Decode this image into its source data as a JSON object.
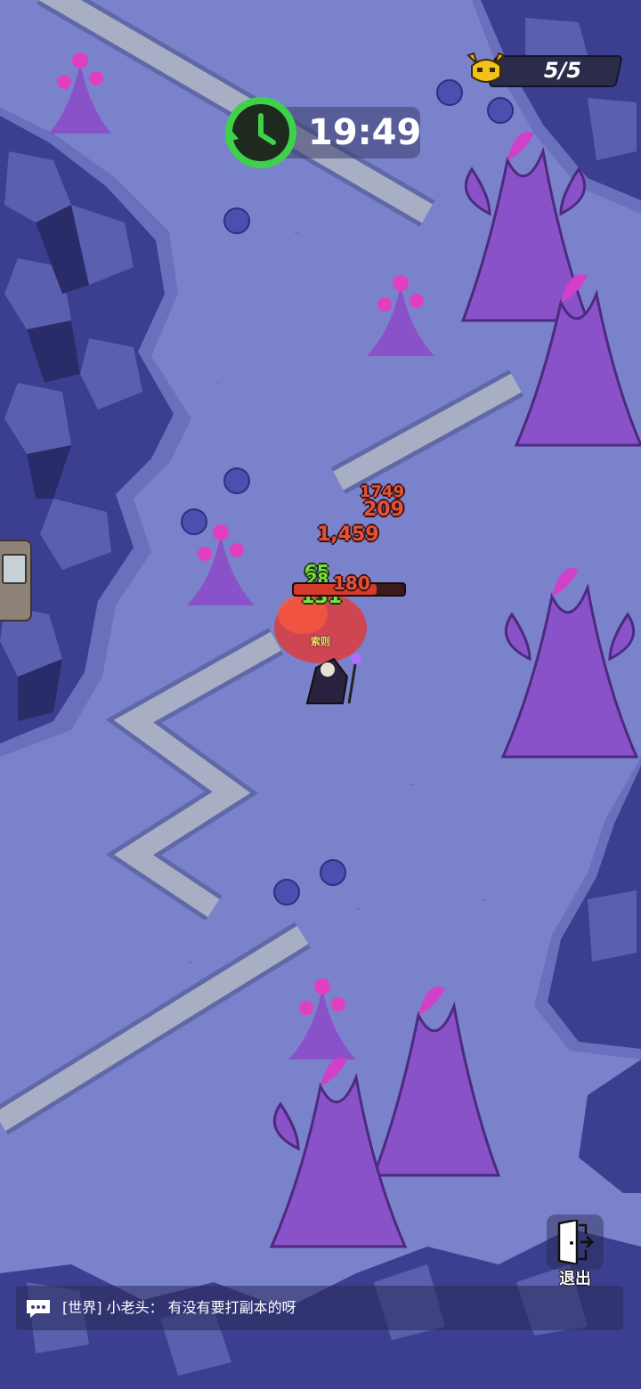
{
  "hud": {
    "boss_counter": "5/5",
    "timer": "19:49"
  },
  "player": {
    "name": "索则",
    "hp_fraction": 0.75
  },
  "damage_numbers": {
    "d1": "1749",
    "d2": "209",
    "d3": "1,459",
    "d4": "65",
    "d5": "28",
    "d6": "131",
    "d7": "180"
  },
  "buttons": {
    "exit_label": "退出"
  },
  "chat": {
    "channel": "[世界]",
    "sender": "小老头",
    "text": "有没有要打副本的呀",
    "full": "[世界] 小老头： 有没有要打副本的呀"
  },
  "colors": {
    "ground": "#7b82cc",
    "rock": "#3c3f8f",
    "path": "#a8aec4",
    "plant": "#8a52c8",
    "timer_green": "#3ed14a"
  }
}
